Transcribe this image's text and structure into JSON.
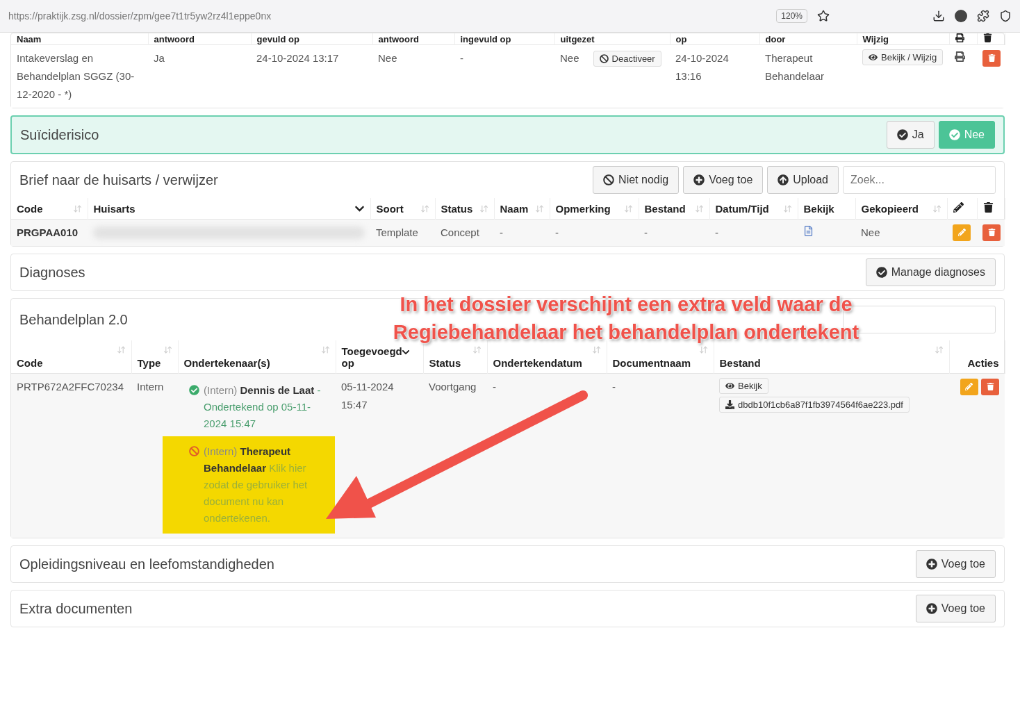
{
  "browser": {
    "url": "https://praktijk.zsg.nl/dossier/zpm/gee7t1tr5yw2rz4l1eppe0nx",
    "zoom": "120%"
  },
  "questionnaires": {
    "columns": [
      "Naam",
      "antwoord",
      "gevuld op",
      "antwoord",
      "ingevuld op",
      "uitgezet",
      "op",
      "door",
      "Wijzig"
    ],
    "rows": [
      {
        "name": "Intakeverslag en Behandelplan SGGZ (30-12-2020 - *)",
        "answer": "Ja",
        "filled": "24-10-2024 13:17",
        "answer2": "Nee",
        "filled2": "-",
        "disabled": "Nee",
        "deactivate": "Deactiveer",
        "on": "24-10-2024 13:16",
        "by": "Therapeut Behandelaar",
        "edit": "Bekijk / Wijzig"
      }
    ]
  },
  "suicide_risk": {
    "title": "Suïciderisico",
    "options": [
      {
        "label": "Ja",
        "selected": false
      },
      {
        "label": "Nee",
        "selected": true
      }
    ]
  },
  "referral_letter": {
    "title": "Brief naar de huisarts / verwijzer",
    "buttons": [
      {
        "kind": "decline",
        "label": "Niet nodig"
      },
      {
        "kind": "add",
        "label": "Voeg toe"
      },
      {
        "kind": "upload",
        "label": "Upload"
      }
    ],
    "search_placeholder": "Zoek...",
    "columns": [
      "Code",
      "Huisarts",
      "Soort",
      "Status",
      "Naam",
      "Opmerking",
      "Bestand",
      "Datum/Tijd",
      "Bekijk",
      "Gekopieerd"
    ],
    "rows": [
      {
        "code": "PRGPAA010",
        "type": "Template",
        "status": "Concept",
        "name": "-",
        "remark": "-",
        "file": "-",
        "datetime": "-",
        "copied": "Nee"
      }
    ]
  },
  "diagnoses": {
    "title": "Diagnoses",
    "button": "Manage diagnoses"
  },
  "treatment_plan": {
    "title": "Behandelplan 2.0",
    "columns": [
      "Code",
      "Type",
      "Ondertekenaar(s)",
      "Toegevoegd op",
      "Status",
      "Ondertekendatum",
      "Documentnaam",
      "Bestand",
      "Acties"
    ],
    "rows": [
      {
        "code": "PRTP672A2FFC70234",
        "type": "Intern",
        "added": "05-11-2024 15:47",
        "status": "Voortgang",
        "signed_date": "-",
        "doc_name": "-",
        "view": "Bekijk",
        "file": "dbdb10f1cb6a87f1fb3974564f6ae223.pdf",
        "signers": [
          {
            "kind": "signed",
            "highlighted": false,
            "prefix": "(Intern)",
            "name": "Dennis de Laat",
            "note": "- Ondertekend op 05-11-2024 15:47"
          },
          {
            "kind": "pending",
            "highlighted": true,
            "prefix": "(Intern)",
            "name": "Therapeut Behandelaar",
            "note": "Klik hier zodat de gebruiker het document nu kan ondertekenen."
          }
        ]
      }
    ]
  },
  "sections": [
    {
      "title": "Opleidingsniveau en leefomstandigheden",
      "button": "Voeg toe"
    },
    {
      "title": "Extra documenten",
      "button": "Voeg toe"
    }
  ],
  "callout": [
    "In het dossier verschijnt een extra veld waar de",
    "Regiebehandelaar het behandelplan ondertekent"
  ]
}
